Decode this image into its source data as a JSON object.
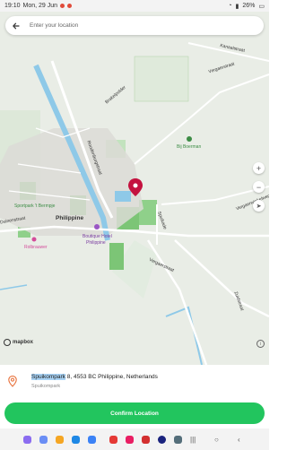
{
  "status_bar": {
    "time": "19:10",
    "date": "Mon, 29 Jun",
    "battery": "26%"
  },
  "search": {
    "placeholder": "Enter your location"
  },
  "map": {
    "labels": {
      "philippine": "Philippine",
      "boutique_hotel_1": "Boutique Hotel",
      "boutique_hotel_2": "Philippine",
      "sportpark": "Sportpark 't Bermpje",
      "bij_boerman": "Bij Boerman",
      "rolbrauwer": "Rolbrauwer",
      "vergaerstraat": "Vergaerstraat",
      "vergaerstraat_south": "Vergaerstraat",
      "vergaerwinkelweg": "Vergaerwinkelweg",
      "kanaalstraat": "Kanaalstraat",
      "zuidstraat": "Zuidstraat",
      "brakelpolder": "Brakelpolder",
      "roodenburgstraat": "Roodenburgstraat",
      "spuikade": "Spuikade",
      "duinenstraat": "Duinenstraat"
    },
    "attribution": "mapbox"
  },
  "location": {
    "highlight": "Spuikompark",
    "rest": " 8, 4553 BC Philippine, Netherlands",
    "subtitle": "Spuikompark"
  },
  "confirm_label": "Confirm Location",
  "colors": {
    "accent": "#22c55e",
    "pin": "#c4123f",
    "water": "#8ec9e8",
    "park": "#7cc576"
  }
}
